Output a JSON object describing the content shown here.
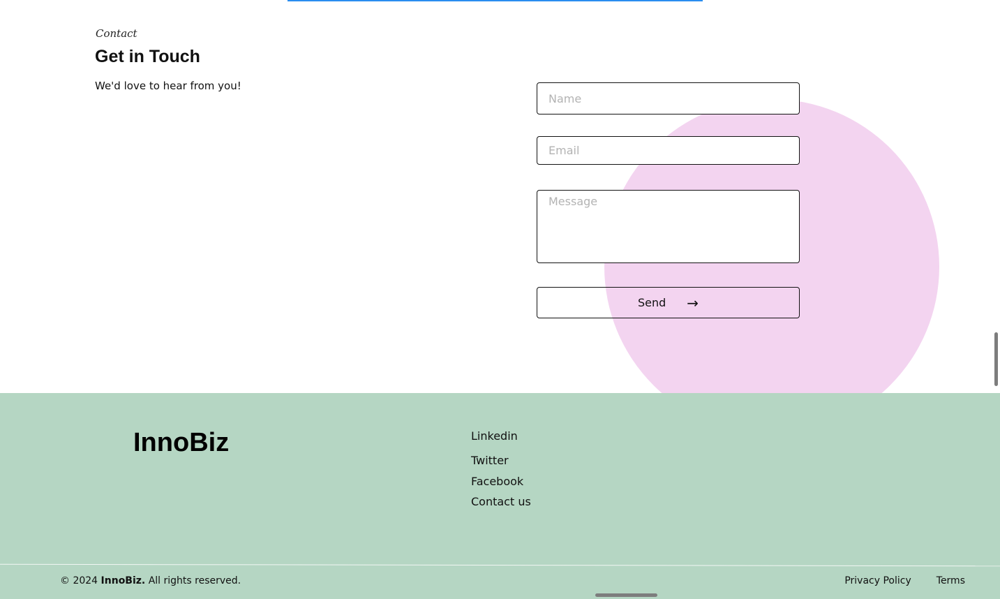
{
  "contact": {
    "eyebrow": "Contact",
    "heading": "Get in Touch",
    "subtext": "We'd love to hear from you!",
    "form": {
      "name_placeholder": "Name",
      "email_placeholder": "Email",
      "message_placeholder": "Message",
      "send_label": "Send",
      "send_arrow": "→"
    }
  },
  "footer": {
    "brand": "InnoBiz",
    "links": [
      {
        "label": "Linkedin"
      },
      {
        "label": "Twitter"
      },
      {
        "label": "Facebook"
      },
      {
        "label": "Contact us"
      }
    ],
    "copyright_prefix": "© 2024",
    "copyright_brand": "InnoBiz.",
    "copyright_suffix": "All rights reserved.",
    "legal": {
      "privacy": "Privacy Policy",
      "terms": "Terms"
    }
  },
  "colors": {
    "accent_line": "#2a8df0",
    "blob": "#f3d4f0",
    "footer_bg": "#b5d6c3"
  }
}
